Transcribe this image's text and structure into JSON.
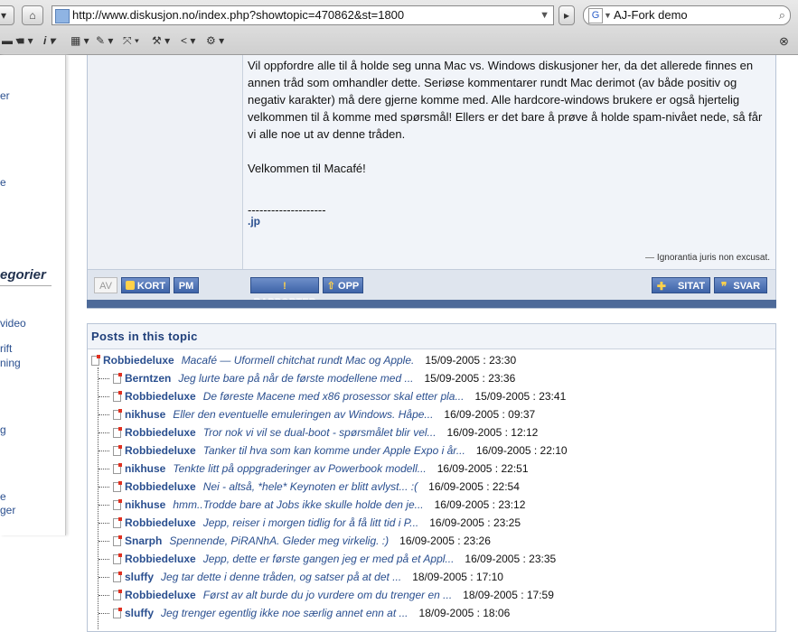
{
  "browser": {
    "url": "http://www.diskusjon.no/index.php?showtopic=470862&st=1800",
    "search_engine_letter": "G",
    "search_value": "AJ-Fork  demo",
    "toolbar_items": [
      "▪︎",
      "▪︎",
      "i",
      "▪︎",
      "✎",
      "▪︎",
      "⚒",
      "<",
      "⚙"
    ]
  },
  "sidebar": {
    "fragments": [
      "er",
      "e",
      "video",
      "rift",
      "ning",
      "g",
      "e",
      "ger"
    ],
    "heading": "egorier"
  },
  "post": {
    "paragraphs": [
      "Vil oppfordre alle til å holde seg unna Mac vs. Windows diskusjoner her, da det allerede finnes en annen tråd som omhandler dette. Seriøse kommentarer rundt Mac derimot (av både positiv og negativ karakter) må dere gjerne komme med. Alle hardcore-windows brukere er også hjertelig velkommen til å komme med spørsmål! Ellers er det bare å prøve å holde spam-nivået nede, så får vi alle noe ut av denne tråden.",
      "Velkommen til Macafé!"
    ],
    "sig_separator": "--------------------",
    "signature": ".jp",
    "motto": "Ignorantia juris non excusat.",
    "buttons": {
      "av": "AV",
      "kort": "KORT",
      "pm": "PM",
      "rapporter": "RAPPORTER",
      "opp": "OPP",
      "sitat": "SITAT",
      "svar": "SVAR"
    }
  },
  "topic": {
    "header": "Posts in this topic",
    "posts": [
      {
        "author": "Robbiedeluxe",
        "title": "Macafé — Uformell chitchat rundt Mac og Apple.",
        "date": "15/09-2005 : 23:30"
      },
      {
        "author": "Berntzen",
        "title": "Jeg lurte bare på når de første modellene med ...",
        "date": "15/09-2005 : 23:36"
      },
      {
        "author": "Robbiedeluxe",
        "title": "De føreste Macene med x86 prosessor skal etter pla...",
        "date": "15/09-2005 : 23:41"
      },
      {
        "author": "nikhuse",
        "title": "Eller den eventuelle emuleringen av Windows. Håpe...",
        "date": "16/09-2005 : 09:37"
      },
      {
        "author": "Robbiedeluxe",
        "title": "Tror nok vi vil se dual-boot - spørsmålet blir vel...",
        "date": "16/09-2005 : 12:12"
      },
      {
        "author": "Robbiedeluxe",
        "title": "Tanker til hva som kan komme under Apple Expo i år...",
        "date": "16/09-2005 : 22:10"
      },
      {
        "author": "nikhuse",
        "title": "Tenkte litt på oppgraderinger av Powerbook modell...",
        "date": "16/09-2005 : 22:51"
      },
      {
        "author": "Robbiedeluxe",
        "title": "Nei - altså, *hele* Keynoten er blitt avlyst... :(",
        "date": "16/09-2005 : 22:54"
      },
      {
        "author": "nikhuse",
        "title": "hmm..Trodde bare at Jobs ikke skulle holde den je...",
        "date": "16/09-2005 : 23:12"
      },
      {
        "author": "Robbiedeluxe",
        "title": "Jepp, reiser i morgen tidlig for å få litt tid i P...",
        "date": "16/09-2005 : 23:25"
      },
      {
        "author": "Snarph",
        "title": "Spennende, PiRANhA. Gleder meg virkelig. :)",
        "date": "16/09-2005 : 23:26"
      },
      {
        "author": "Robbiedeluxe",
        "title": "Jepp, dette er første gangen jeg er med på et Appl...",
        "date": "16/09-2005 : 23:35"
      },
      {
        "author": "sluffy",
        "title": "Jeg tar dette i denne tråden, og satser på at det ...",
        "date": "18/09-2005 : 17:10"
      },
      {
        "author": "Robbiedeluxe",
        "title": "Først av alt burde du jo vurdere om du trenger en ...",
        "date": "18/09-2005 : 17:59"
      },
      {
        "author": "sluffy",
        "title": "Jeg trenger egentlig ikke noe særlig annet enn at ...",
        "date": "18/09-2005 : 18:06"
      }
    ]
  }
}
